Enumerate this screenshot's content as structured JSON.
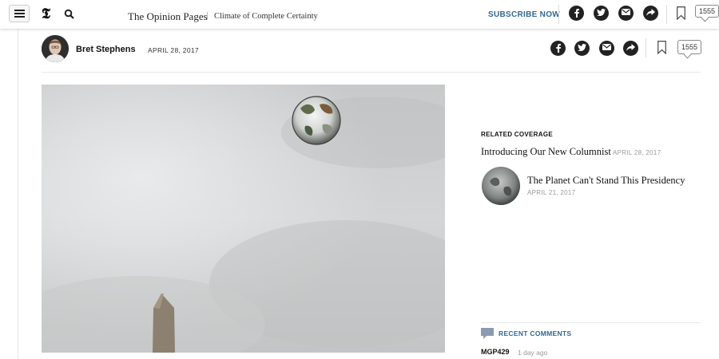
{
  "header": {
    "logo": "𝕿",
    "section": "The Opinion Pages",
    "subtitle": "Climate of Complete Certainty",
    "subscribe_label": "SUBSCRIBE NOW",
    "comment_count": "1555",
    "icons": [
      "menu-icon",
      "search-icon",
      "facebook-icon",
      "twitter-icon",
      "email-icon",
      "share-icon",
      "bookmark-icon",
      "comment-icon"
    ]
  },
  "byline": {
    "author": "Bret Stephens",
    "date": "APRIL 28, 2017",
    "comment_count": "1555"
  },
  "related": {
    "heading": "RELATED COVERAGE",
    "items": [
      {
        "title": "Introducing Our New Columnist",
        "date": "APRIL 28, 2017"
      },
      {
        "title": "The Planet Can't Stand This Presidency",
        "date": "APRIL 21, 2017"
      }
    ]
  },
  "comments": {
    "heading": "RECENT COMMENTS",
    "items": [
      {
        "user": "MGP429",
        "time": "1 day ago"
      }
    ]
  },
  "colors": {
    "link_blue": "#326891",
    "text": "#121212",
    "muted": "#999999"
  }
}
